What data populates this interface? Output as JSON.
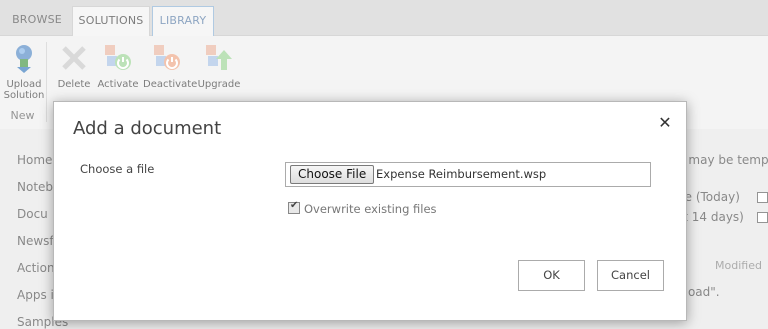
{
  "ribbon": {
    "tabs": [
      "BROWSE",
      "SOLUTIONS",
      "LIBRARY"
    ],
    "buttons": {
      "upload": "Upload Solution",
      "upload_line1": "Upload",
      "upload_line2": "Solution",
      "delete": "Delete",
      "activate": "Activate",
      "deactivate": "Deactivate",
      "upgrade": "Upgrade"
    },
    "group_label": "New"
  },
  "background": {
    "left_nav": [
      "Home",
      "Notebo",
      "Docu",
      "Newsf",
      "Action",
      "Apps i",
      "Samples"
    ],
    "right_fragments": {
      "line1": "d may be temp",
      "line2": "ge (Today)",
      "line3": "st 14 days)",
      "modified": "Modified",
      "upload_note": "pload\"."
    }
  },
  "dialog": {
    "title": "Add a document",
    "close_symbol": "✕",
    "choose_label": "Choose a file",
    "choose_button": "Choose File",
    "file_name": "Expense Reimbursement.wsp",
    "overwrite_label": "Overwrite existing files",
    "overwrite_checked": true,
    "ok": "OK",
    "cancel": "Cancel"
  },
  "colors": {
    "tab_library_border": "#8fb4d6",
    "icon_orange": "#e3885e",
    "icon_green": "#7cc36c",
    "icon_blue": "#8db3e2"
  }
}
